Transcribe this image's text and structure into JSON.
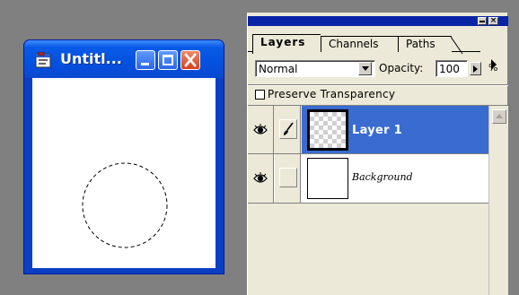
{
  "document_window": {
    "title": "Untitl...",
    "colors": {
      "titlebar": "#0451df",
      "close_button": "#d8401c",
      "canvas": "#ffffff"
    }
  },
  "layers_palette": {
    "tabs": [
      {
        "label": "Layers",
        "active": true
      },
      {
        "label": "Channels",
        "active": false
      },
      {
        "label": "Paths",
        "active": false
      }
    ],
    "blend_mode": "Normal",
    "opacity_label": "Opacity:",
    "opacity_value": "100",
    "opacity_unit": "%",
    "preserve_transparency_label": "Preserve Transparency",
    "preserve_transparency_checked": false,
    "layers": [
      {
        "name": "Layer 1",
        "selected": true,
        "visible": true,
        "brush_link": true,
        "thumbnail": "transparent-checkerboard"
      },
      {
        "name": "Background",
        "selected": false,
        "visible": true,
        "brush_link": false,
        "thumbnail": "white"
      }
    ],
    "colors": {
      "selected_row": "#3a6ccf",
      "panel_bg": "#ece9d8",
      "titlebar": "#0a24a6"
    }
  },
  "icons": [
    "app-document-icon",
    "minimize-icon",
    "maximize-icon",
    "close-icon",
    "eye-icon",
    "paintbrush-icon",
    "palette-menu-arrow-icon",
    "dropdown-arrow-icon",
    "scroll-up-arrow-icon"
  ]
}
